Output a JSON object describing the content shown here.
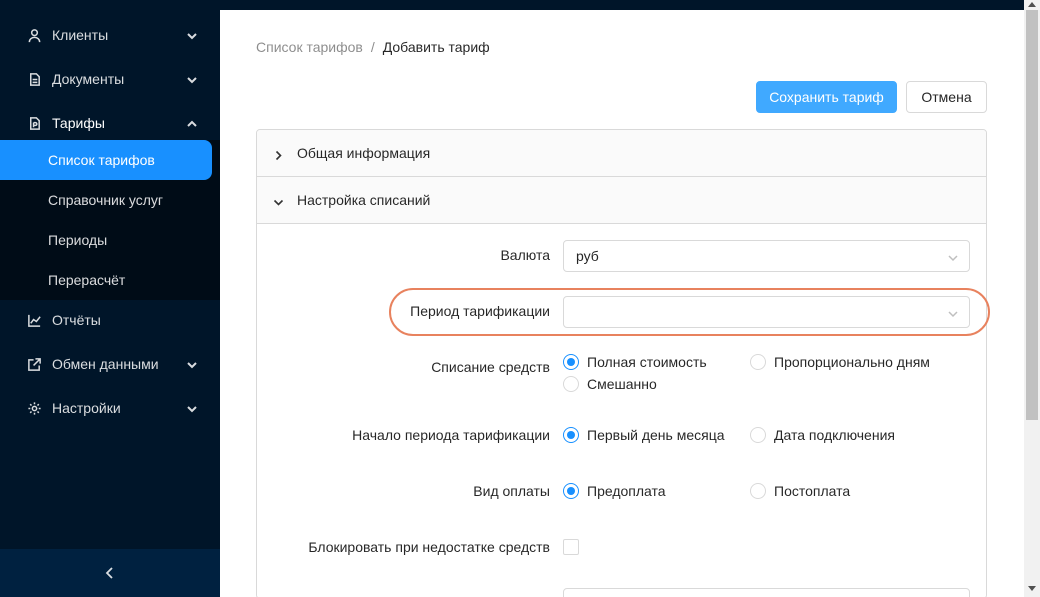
{
  "sidebar": {
    "items": [
      {
        "label": "Клиенты",
        "icon": "user-icon"
      },
      {
        "label": "Документы",
        "icon": "document-icon"
      },
      {
        "label": "Тарифы",
        "icon": "tariff-icon"
      },
      {
        "label": "Отчёты",
        "icon": "chart-icon"
      },
      {
        "label": "Обмен данными",
        "icon": "exchange-icon"
      },
      {
        "label": "Настройки",
        "icon": "gear-icon"
      }
    ],
    "submenu": [
      {
        "label": "Список тарифов",
        "active": true
      },
      {
        "label": "Справочник услуг"
      },
      {
        "label": "Периоды"
      },
      {
        "label": "Перерасчёт"
      }
    ]
  },
  "breadcrumb": {
    "prev": "Список тарифов",
    "separator": "/",
    "current": "Добавить тариф"
  },
  "actions": {
    "save_label": "Сохранить тариф",
    "cancel_label": "Отмена"
  },
  "panels": {
    "general": "Общая информация",
    "charges": "Настройка списаний"
  },
  "form": {
    "currency": {
      "label": "Валюта",
      "value": "руб"
    },
    "period": {
      "label": "Период тарификации",
      "value": ""
    },
    "charge": {
      "label": "Списание средств",
      "options": [
        "Полная стоимость",
        "Пропорционально дням",
        "Смешанно"
      ],
      "selected": "Полная стоимость"
    },
    "period_start": {
      "label": "Начало периода тарификации",
      "options": [
        "Первый день месяца",
        "Дата подключения"
      ],
      "selected": "Первый день месяца"
    },
    "payment_type": {
      "label": "Вид оплаты",
      "options": [
        "Предоплата",
        "Постоплата"
      ],
      "selected": "Предоплата"
    },
    "block_low_funds": {
      "label": "Блокировать при недостатке средств",
      "checked": false
    }
  },
  "colors": {
    "sidebar_bg": "#001529",
    "submenu_bg": "#000c17",
    "accent": "#1890ff",
    "primary_button": "#40a9ff",
    "highlight": "#e8825e"
  }
}
